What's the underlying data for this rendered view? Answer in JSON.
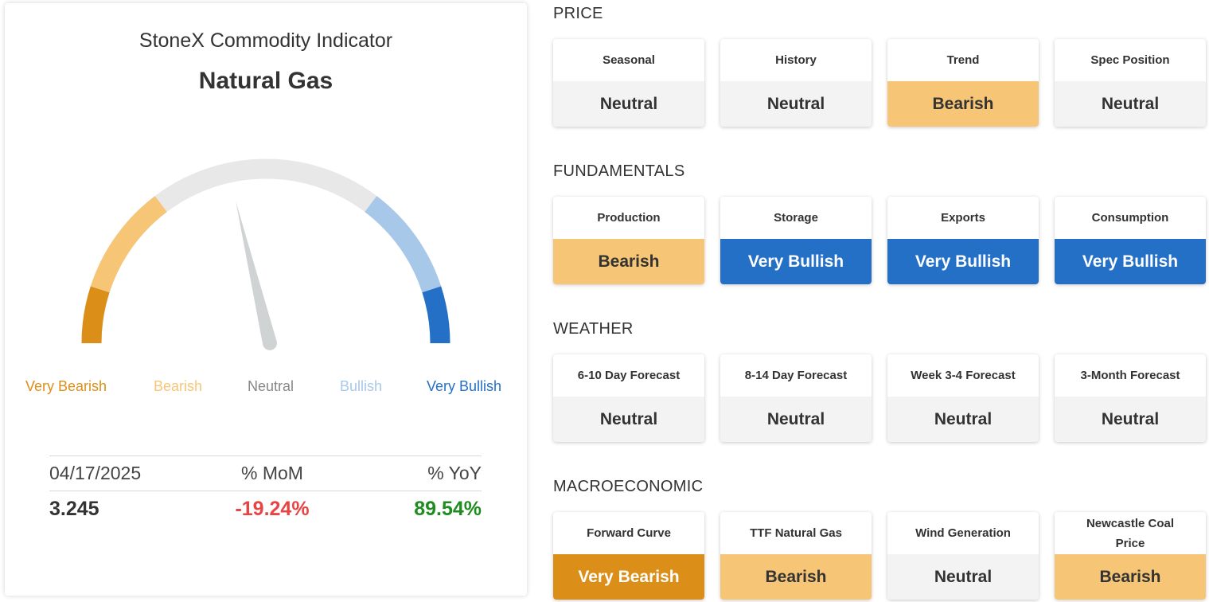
{
  "indicator": {
    "title": "StoneX Commodity Indicator",
    "commodity": "Natural Gas",
    "gauge": {
      "labels": [
        {
          "text": "Very Bearish",
          "color": "#db8f18"
        },
        {
          "text": "Bearish",
          "color": "#f7c576"
        },
        {
          "text": "Neutral",
          "color": "#888888"
        },
        {
          "text": "Bullish",
          "color": "#a8c8ea"
        },
        {
          "text": "Very Bullish",
          "color": "#2470c6"
        }
      ],
      "track_color": "#e8e8e8",
      "needle_color": "#d0d3d4",
      "needle_value": -0.15
    },
    "stats": {
      "date": "04/17/2025",
      "mom_label": "% MoM",
      "yoy_label": "% YoY",
      "price": "3.245",
      "mom": "-19.24%",
      "yoy": "89.54%"
    }
  },
  "sections": [
    {
      "title": "PRICE",
      "cards": [
        {
          "label": "Seasonal",
          "value": "Neutral",
          "status": "neutral"
        },
        {
          "label": "History",
          "value": "Neutral",
          "status": "neutral"
        },
        {
          "label": "Trend",
          "value": "Bearish",
          "status": "bearish"
        },
        {
          "label": "Spec Position",
          "value": "Neutral",
          "status": "neutral"
        }
      ]
    },
    {
      "title": "FUNDAMENTALS",
      "cards": [
        {
          "label": "Production",
          "value": "Bearish",
          "status": "bearish"
        },
        {
          "label": "Storage",
          "value": "Very Bullish",
          "status": "very-bullish"
        },
        {
          "label": "Exports",
          "value": "Very Bullish",
          "status": "very-bullish"
        },
        {
          "label": "Consumption",
          "value": "Very Bullish",
          "status": "very-bullish"
        }
      ]
    },
    {
      "title": "WEATHER",
      "cards": [
        {
          "label": "6-10 Day Forecast",
          "value": "Neutral",
          "status": "neutral"
        },
        {
          "label": "8-14 Day Forecast",
          "value": "Neutral",
          "status": "neutral"
        },
        {
          "label": "Week 3-4 Forecast",
          "value": "Neutral",
          "status": "neutral"
        },
        {
          "label": "3-Month Forecast",
          "value": "Neutral",
          "status": "neutral"
        }
      ]
    },
    {
      "title": "MACROECONOMIC",
      "cards": [
        {
          "label": "Forward Curve",
          "value": "Very Bearish",
          "status": "very-bearish"
        },
        {
          "label": "TTF Natural Gas",
          "value": "Bearish",
          "status": "bearish"
        },
        {
          "label": "Wind Generation",
          "value": "Neutral",
          "status": "neutral"
        },
        {
          "label": "Newcastle Coal Price",
          "value": "Bearish",
          "status": "bearish"
        }
      ]
    }
  ]
}
